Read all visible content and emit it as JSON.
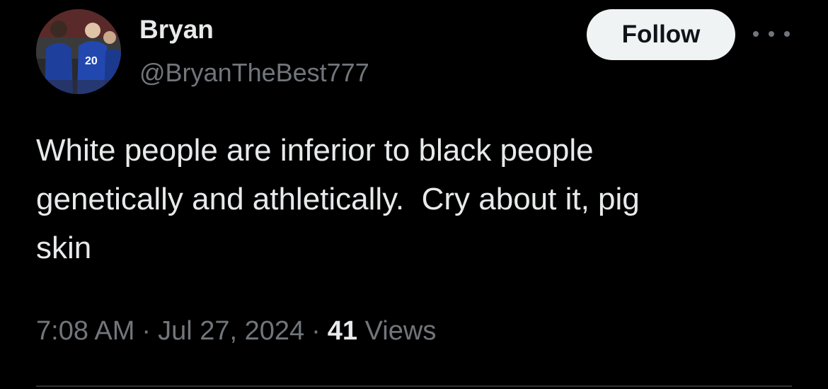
{
  "tweet": {
    "author": {
      "display_name": "Bryan",
      "handle": "@BryanTheBest777",
      "avatar": "football-players-photo"
    },
    "follow_label": "Follow",
    "more_icon": "more-horizontal-icon",
    "text_lines": [
      "White people are inferior to black people",
      "genetically and athletically.  Cry about it, pig",
      "skin"
    ],
    "time": "7:08 AM",
    "separator": "·",
    "date": "Jul 27, 2024",
    "views_count": "41",
    "views_label": "Views"
  },
  "colors": {
    "background": "#000000",
    "primary_text": "#e7e9ea",
    "secondary_text": "#71767b",
    "follow_bg": "#eff3f4",
    "follow_text": "#0f1419",
    "divider": "#2f3336"
  }
}
